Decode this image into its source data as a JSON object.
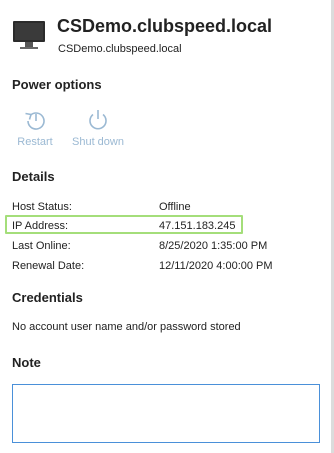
{
  "header": {
    "title": "CSDemo.clubspeed.local",
    "subtitle": "CSDemo.clubspeed.local",
    "icon": "monitor-icon"
  },
  "power": {
    "title": "Power options",
    "restart_label": "Restart",
    "shutdown_label": "Shut down",
    "icon_color": "#9bb9d3"
  },
  "details": {
    "title": "Details",
    "rows": [
      {
        "label": "Host Status:",
        "value": "Offline"
      },
      {
        "label": "IP Address:",
        "value": "47.151.183.245"
      },
      {
        "label": "Last Online:",
        "value": "8/25/2020 1:35:00 PM"
      },
      {
        "label": "Renewal Date:",
        "value": "12/11/2020 4:00:00 PM"
      }
    ],
    "highlight_color": "#a4de7a"
  },
  "credentials": {
    "title": "Credentials",
    "text": "No account user name and/or password stored"
  },
  "note": {
    "title": "Note",
    "value": ""
  }
}
